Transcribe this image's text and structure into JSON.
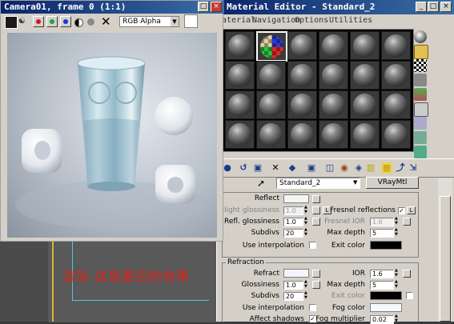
{
  "camera_window": {
    "title": "Camera01, frame 0 (1:1)",
    "channel": "RGB Alpha",
    "toolbar_icons": [
      "save-icon",
      "clone-icon",
      "red-channel-icon",
      "green-channel-icon",
      "blue-channel-icon",
      "mono-icon",
      "alpha-icon",
      "clear-icon"
    ]
  },
  "material_editor": {
    "title": "Material Editor - Standard_2",
    "menu": [
      "Material",
      "Navigation",
      "Options",
      "Utilities"
    ],
    "material_name": "Standard_2",
    "material_type": "VRayMtl",
    "reflect": {
      "reflect_label": "Reflect",
      "hilight_glossiness_label": "Hilight glossiness",
      "hilight_glossiness_value": "1.0",
      "l_label": "L",
      "fresnel_reflections_label": "Fresnel reflections",
      "fresnel_l_label": "L",
      "refl_glossiness_label": "Refl. glossiness",
      "refl_glossiness_value": "1.0",
      "fresnel_ior_label": "Fresnel IOR",
      "fresnel_ior_value": "1.6",
      "subdivs_label": "Subdivs",
      "subdivs_value": "20",
      "max_depth_label": "Max depth",
      "max_depth_value": "5",
      "use_interpolation_label": "Use interpolation",
      "exit_color_label": "Exit color"
    },
    "refraction": {
      "group_label": "Refraction",
      "refract_label": "Refract",
      "ior_label": "IOR",
      "ior_value": "1.6",
      "glossiness_label": "Glossiness",
      "glossiness_value": "1.0",
      "max_depth_label": "Max depth",
      "max_depth_value": "5",
      "subdivs_label": "Subdivs",
      "subdivs_value": "20",
      "exit_color_label": "Exit color",
      "use_interpolation_label": "Use interpolation",
      "fog_color_label": "Fog color",
      "affect_shadows_label": "Affect shadows",
      "fog_multiplier_label": "Fog multiplier",
      "fog_multiplier_value": "0.02"
    }
  },
  "caption": "渲染   这是最后的效果"
}
